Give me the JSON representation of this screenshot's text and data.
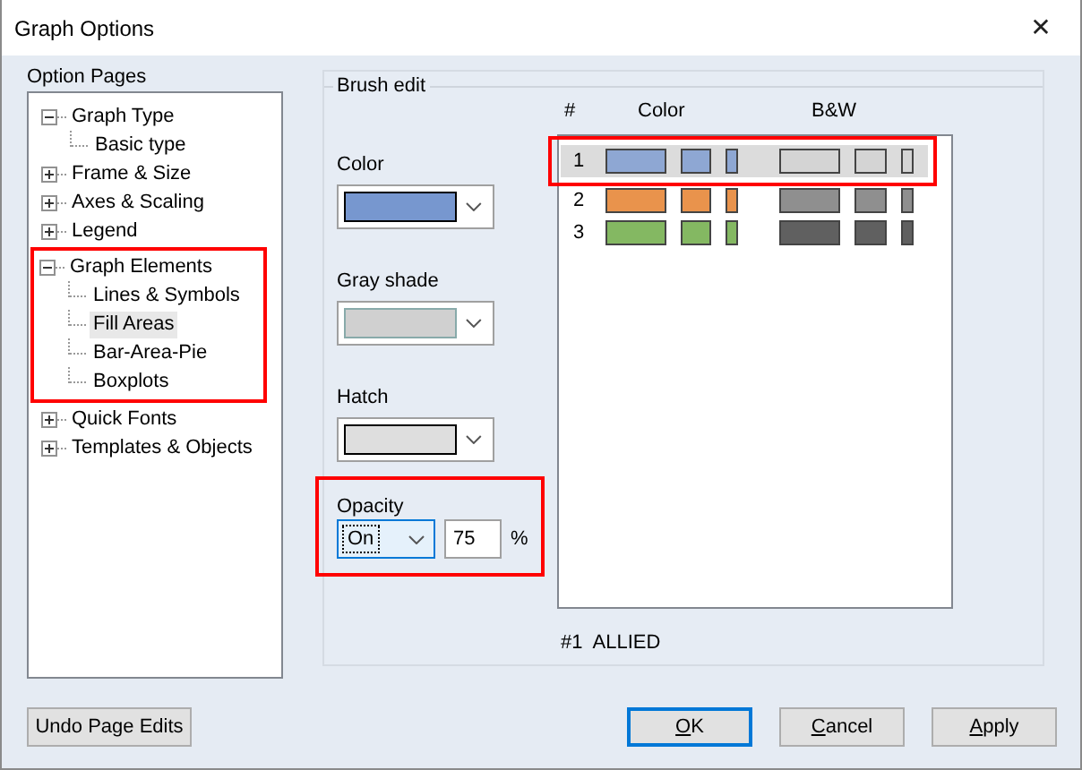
{
  "window": {
    "title": "Graph Options",
    "close_glyph": "✕"
  },
  "option_pages": {
    "label": "Option Pages",
    "tree": [
      {
        "label": "Graph Type",
        "expanded": true,
        "highlighted": false,
        "selected": false,
        "children": [
          {
            "label": "Basic type",
            "selected": false
          }
        ]
      },
      {
        "label": "Frame & Size",
        "expanded": false,
        "highlighted": false,
        "selected": false
      },
      {
        "label": "Axes & Scaling",
        "expanded": false,
        "highlighted": false,
        "selected": false
      },
      {
        "label": "Legend",
        "expanded": false,
        "highlighted": false,
        "selected": false
      },
      {
        "label": "Graph Elements",
        "expanded": true,
        "highlighted": true,
        "selected": false,
        "children": [
          {
            "label": "Lines & Symbols",
            "selected": false
          },
          {
            "label": "Fill Areas",
            "selected": true
          },
          {
            "label": "Bar-Area-Pie",
            "selected": false
          },
          {
            "label": "Boxplots",
            "selected": false
          }
        ]
      },
      {
        "label": "Quick Fonts",
        "expanded": false,
        "highlighted": false,
        "selected": false
      },
      {
        "label": "Templates & Objects",
        "expanded": false,
        "highlighted": false,
        "selected": false
      }
    ]
  },
  "brush_edit": {
    "label": "Brush edit",
    "fields": [
      {
        "label": "Color",
        "color": "#7797cf"
      },
      {
        "label": "Gray shade",
        "color": "#d0d0d0"
      },
      {
        "label": "Hatch",
        "color": "#dedede"
      }
    ],
    "opacity": {
      "label": "Opacity",
      "value": "On",
      "percent": "75",
      "unit": "%",
      "highlighted": true
    },
    "columns": [
      "#",
      "Color",
      "B&W"
    ],
    "rows": [
      {
        "number": "1",
        "color": "#8ea7d3",
        "bw": {
          "color": "#d4d4d4"
        },
        "selected": true,
        "highlighted": true
      },
      {
        "number": "2",
        "color": "#e9934c",
        "bw": {
          "color": "#8f8f8f"
        },
        "selected": false,
        "highlighted": false
      },
      {
        "number": "3",
        "color": "#84b862",
        "bw": {
          "color": "#606060"
        },
        "selected": false,
        "highlighted": false
      }
    ],
    "status": "#1  ALLIED"
  },
  "buttons": [
    {
      "label": "Undo Page Edits",
      "underline_first": false,
      "default": false
    },
    {
      "label": "OK",
      "underline_first": true,
      "default": true
    },
    {
      "label": "Cancel",
      "underline_first": true,
      "default": false
    },
    {
      "label": "Apply",
      "underline_first": true,
      "default": false
    }
  ]
}
